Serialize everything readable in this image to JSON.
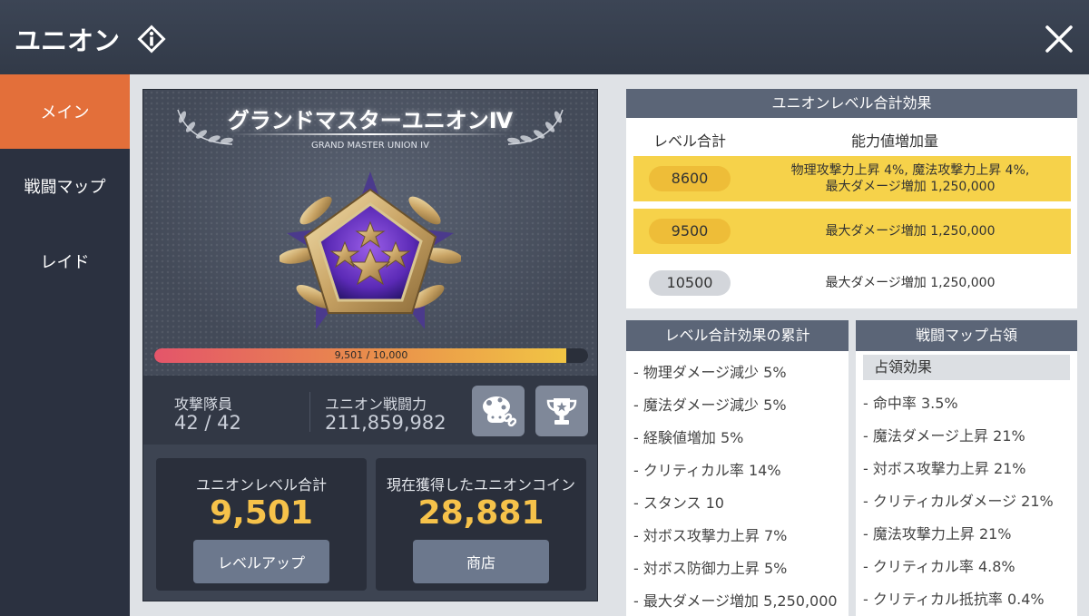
{
  "header": {
    "title": "ユニオン"
  },
  "sidebar": {
    "items": [
      {
        "label": "メイン",
        "active": true
      },
      {
        "label": "戦闘マップ",
        "active": false
      },
      {
        "label": "レイド",
        "active": false
      }
    ]
  },
  "union": {
    "rank_title": "グランドマスターユニオンⅣ",
    "rank_subtitle": "GRAND MASTER UNION IV",
    "progress_text": "9,501 / 10,000",
    "progress_fraction": 0.9501,
    "attack_members_label": "攻撃隊員",
    "attack_members_value": "42 / 42",
    "power_label": "ユニオン戦闘力",
    "power_value": "211,859,982",
    "level_total_label": "ユニオンレベル合計",
    "level_total_value": "9,501",
    "levelup_label": "レベルアップ",
    "coin_label": "現在獲得したユニオンコイン",
    "coin_value": "28,881",
    "shop_label": "商店"
  },
  "level_effects": {
    "title": "ユニオンレベル合計効果",
    "col_level": "レベル合計",
    "col_effect": "能力値増加量",
    "rows": [
      {
        "level": "8600",
        "effect": "物理攻撃力上昇 4%, 魔法攻撃力上昇 4%,\n最大ダメージ増加 1,250,000",
        "achieved": true
      },
      {
        "level": "9500",
        "effect": "最大ダメージ増加 1,250,000",
        "achieved": true
      },
      {
        "level": "10500",
        "effect": "最大ダメージ増加 1,250,000",
        "achieved": false
      }
    ]
  },
  "cumulative": {
    "title": "レベル合計効果の累計",
    "items": [
      "- 物理ダメージ減少 5%",
      "- 魔法ダメージ減少 5%",
      "- 経験値増加 5%",
      "- クリティカル率 14%",
      "- スタンス 10",
      "- 対ボス攻撃力上昇 7%",
      "- 対ボス防御力上昇 5%",
      "- 最大ダメージ増加 5,250,000"
    ]
  },
  "occupation": {
    "title": "戦闘マップ占領",
    "section_label": "占領効果",
    "items": [
      "- 命中率 3.5%",
      "- 魔法ダメージ上昇 21%",
      "- 対ボス攻撃力上昇 21%",
      "- クリティカルダメージ 21%",
      "- 魔法攻撃力上昇 21%",
      "- クリティカル率 4.8%",
      "- クリティカル抵抗率 0.4%"
    ]
  },
  "colors": {
    "accent": "#e36f3a",
    "gold": "#f6d24a",
    "value": "#f6c24a"
  }
}
